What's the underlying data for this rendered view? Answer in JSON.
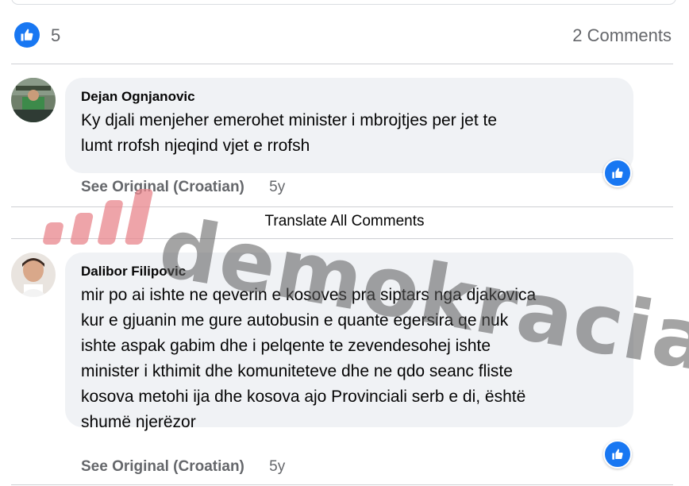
{
  "reactions": {
    "likes": "5",
    "comments": "2 Comments"
  },
  "translate_all": "Translate All Comments",
  "comments": [
    {
      "author": "Dejan Ognjanovic",
      "lines": [
        "Ky djali menjeher emerohet minister i mbrojtjes per jet te",
        "lumt rrofsh njeqind vjet e rrofsh"
      ],
      "see_original": "See Original (Croatian)",
      "age": "5y"
    },
    {
      "author": "Dalibor Filipovic",
      "lines": [
        "mir po ai ishte ne qeverin e kosoves pra siptars nga djakovica",
        "kur e gjuanin me gure autobusin e quante egersira qe nuk",
        "ishte aspak gabim dhe i pelqente te zevendesohej ishte",
        "minister i kthimit dhe komuniteteve dhe ne qdo seanc fliste",
        "kosova metohi ija dhe kosova ajo Provinciali serb e di, është",
        "shumë njerëzor"
      ],
      "see_original": "See Original (Croatian)",
      "age": "5y"
    }
  ],
  "watermark": {
    "text": "demokracia",
    "color": "#e8868c"
  },
  "colors": {
    "accent": "#1877f2",
    "bubble": "#f0f2f5",
    "muted": "#65676b",
    "divider": "#ced0d4"
  },
  "icons": {
    "like": "thumbs-up-icon"
  }
}
